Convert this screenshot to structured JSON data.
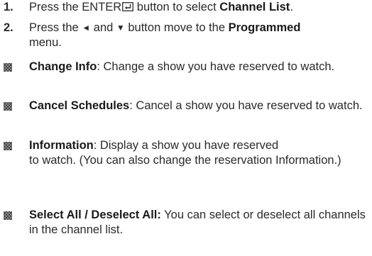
{
  "steps": [
    {
      "number": "1.",
      "t1": "Press the ENTER",
      "t2": " button to select ",
      "b1": "Channel List",
      "t3": "."
    },
    {
      "number": "2.",
      "t1": "Press the ",
      "arrow_left": "◄",
      "t2": " and ",
      "arrow_down": "▼",
      "t3": " button move to the ",
      "b1": "Programmed",
      "t4": "menu."
    }
  ],
  "bullets": [
    {
      "term": "Change Info",
      "sep": ": ",
      "desc": "Change a show you have reserved to watch."
    },
    {
      "term": "Cancel Schedules",
      "sep": ": ",
      "desc": "Cancel a show you have reserved to watch."
    },
    {
      "term": "Information",
      "sep": ": ",
      "desc_line1": "Display a show you have reserved",
      "desc_rest": "to watch. (You can also change the reservation Information.)"
    },
    {
      "term": "Select All / Deselect All:",
      "sep": " ",
      "desc": "You can select or deselect all channels in the channel list."
    }
  ],
  "icons": {
    "enter": "enter-icon",
    "bullet": "square-bullet-icon"
  }
}
